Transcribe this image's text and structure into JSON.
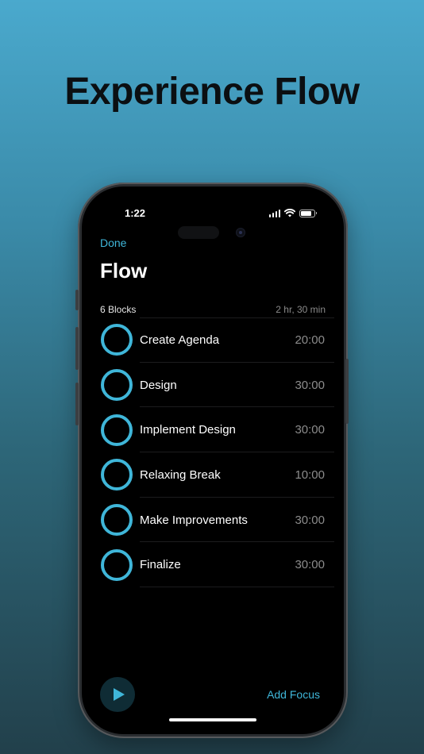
{
  "headline": "Experience Flow",
  "status_bar": {
    "time": "1:22"
  },
  "nav": {
    "done_label": "Done"
  },
  "page": {
    "title": "Flow"
  },
  "summary": {
    "count": "6 Blocks",
    "total": "2 hr, 30 min"
  },
  "blocks": [
    {
      "name": "Create Agenda",
      "duration": "20:00"
    },
    {
      "name": "Design",
      "duration": "30:00"
    },
    {
      "name": "Implement Design",
      "duration": "30:00"
    },
    {
      "name": "Relaxing Break",
      "duration": "10:00"
    },
    {
      "name": "Make Improvements",
      "duration": "30:00"
    },
    {
      "name": "Finalize",
      "duration": "30:00"
    }
  ],
  "footer": {
    "add_focus_label": "Add Focus"
  },
  "icons": {
    "play": "play-icon",
    "ring": "progress-ring-icon"
  },
  "colors": {
    "accent": "#3fb6d9",
    "background_top": "#4aa9cd",
    "background_bottom": "#22404b"
  }
}
